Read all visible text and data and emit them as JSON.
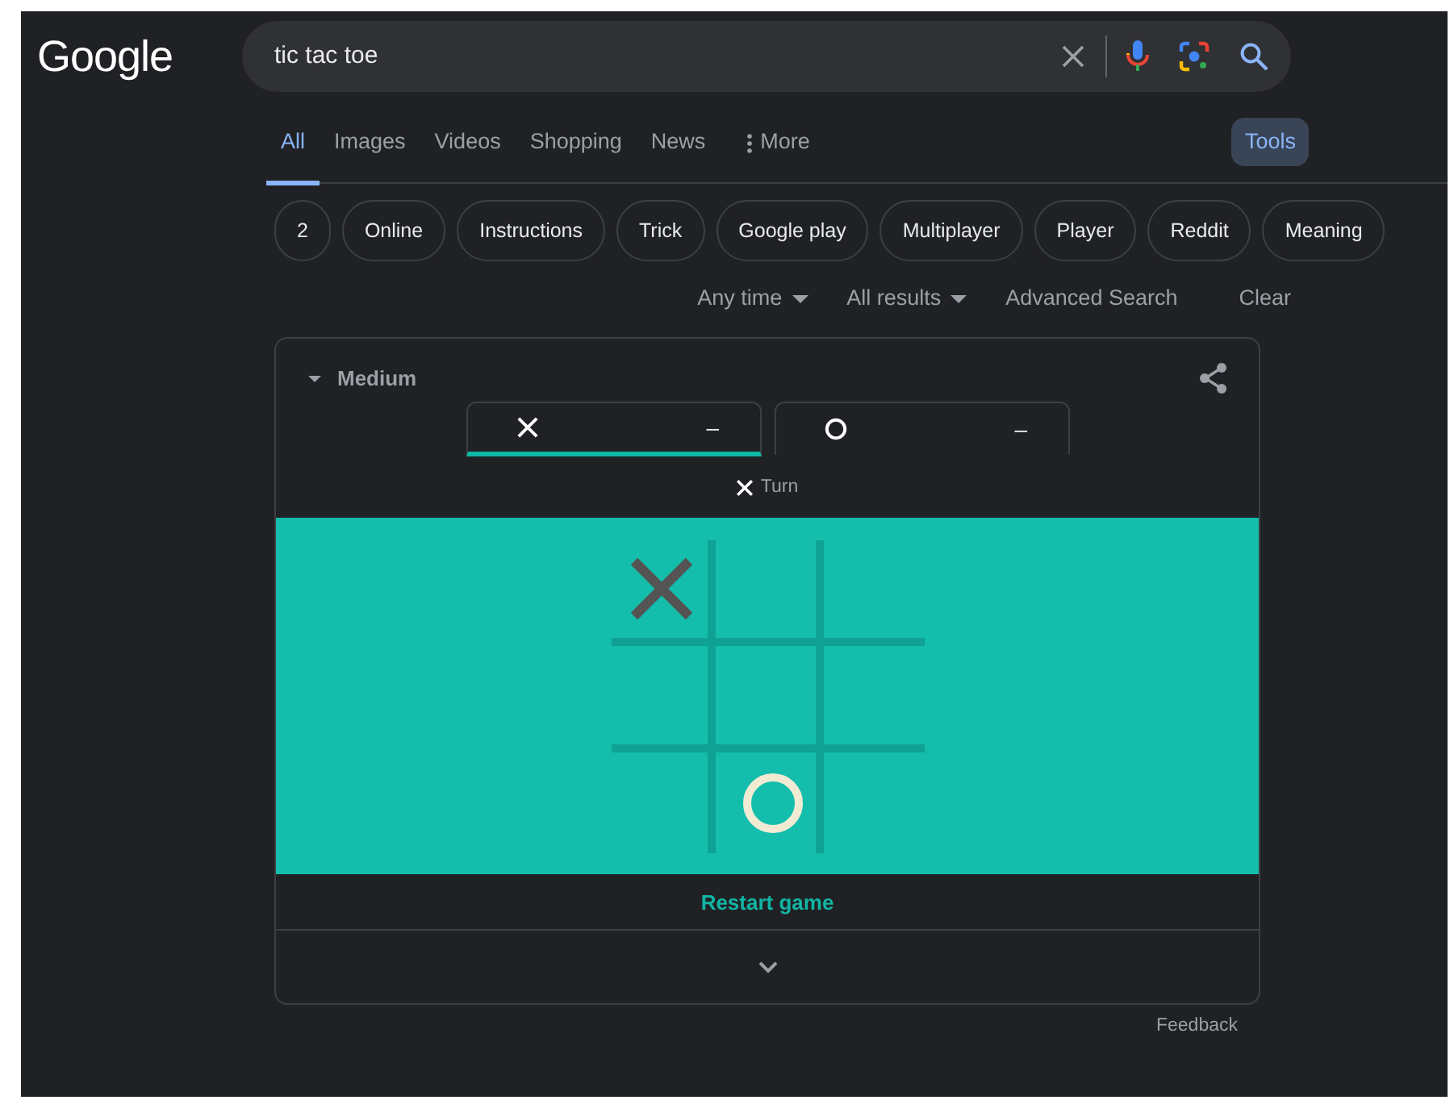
{
  "logo": "Google",
  "search": {
    "value": "tic tac toe"
  },
  "tabs": [
    {
      "label": "All",
      "selected": true
    },
    {
      "label": "Images",
      "selected": false
    },
    {
      "label": "Videos",
      "selected": false
    },
    {
      "label": "Shopping",
      "selected": false
    },
    {
      "label": "News",
      "selected": false
    },
    {
      "label": "More",
      "selected": false,
      "kind": "menu"
    }
  ],
  "tools_button": "Tools",
  "chips": [
    "2",
    "Online",
    "Instructions",
    "Trick",
    "Google play",
    "Multiplayer",
    "Player",
    "Reddit",
    "Meaning"
  ],
  "filters": [
    {
      "label": "Any time",
      "kind": "dropdown"
    },
    {
      "label": "All results",
      "kind": "dropdown"
    },
    {
      "label": "Advanced Search",
      "kind": "link"
    },
    {
      "label": "Clear",
      "kind": "link"
    }
  ],
  "game": {
    "difficulty": "Medium",
    "players": [
      {
        "kind": "x",
        "score": "–",
        "selected": true
      },
      {
        "kind": "o",
        "score": "–",
        "selected": false
      }
    ],
    "turn": {
      "kind": "x",
      "label": "Turn"
    },
    "board": [
      {
        "kind": "x"
      },
      {
        "kind": "empty"
      },
      {
        "kind": "empty"
      },
      {
        "kind": "empty"
      },
      {
        "kind": "empty"
      },
      {
        "kind": "empty"
      },
      {
        "kind": "empty"
      },
      {
        "kind": "o"
      },
      {
        "kind": "empty"
      }
    ],
    "restart": "Restart game"
  },
  "feedback": "Feedback"
}
